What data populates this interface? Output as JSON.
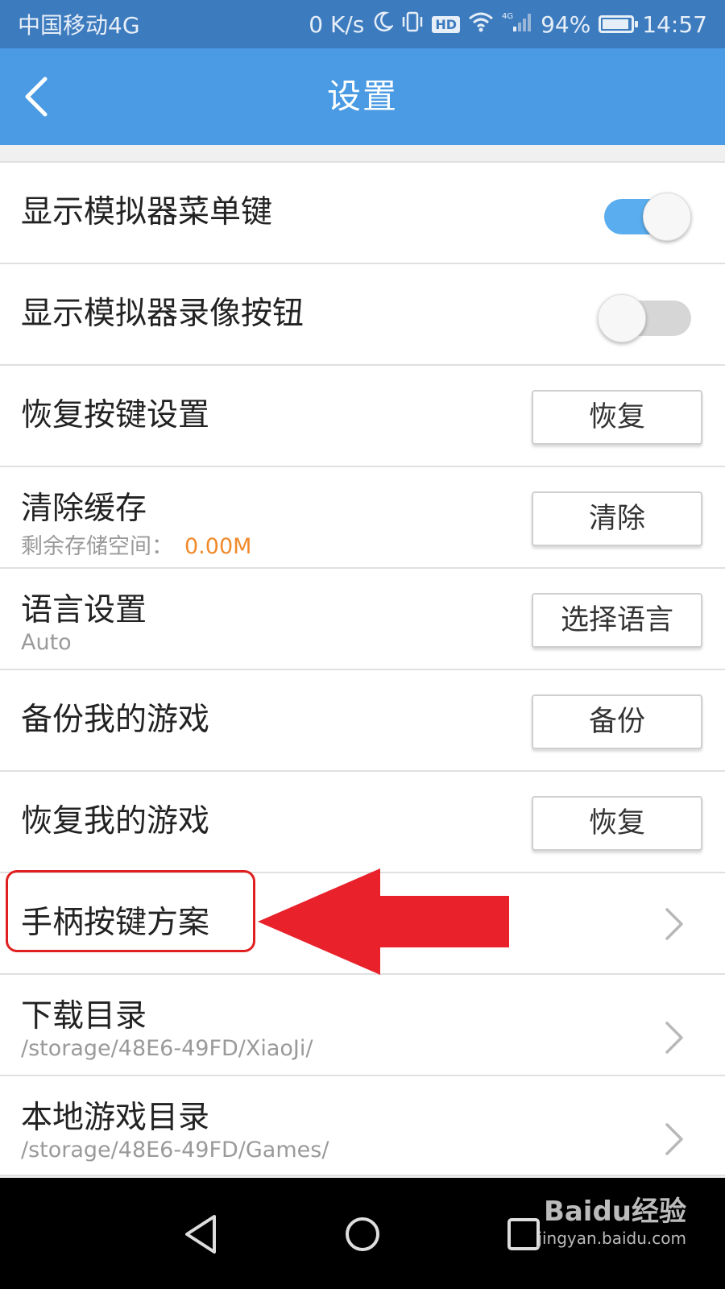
{
  "status_bar": {
    "carrier": "中国移动4G",
    "speed": "0 K/s",
    "hd": "HD",
    "net": "4G",
    "battery": "94%",
    "battery_level": 0.94,
    "time": "14:57"
  },
  "header": {
    "title": "设置"
  },
  "settings": {
    "show_menu_key": {
      "label": "显示模拟器菜单键",
      "on": true
    },
    "show_record_button": {
      "label": "显示模拟器录像按钮",
      "on": false
    },
    "restore_keys": {
      "label": "恢复按键设置",
      "button": "恢复"
    },
    "clear_cache": {
      "label": "清除缓存",
      "sub_label": "剩余存储空间：",
      "sub_value": "0.00M",
      "button": "清除"
    },
    "language": {
      "label": "语言设置",
      "sub": "Auto",
      "button": "选择语言"
    },
    "backup_games": {
      "label": "备份我的游戏",
      "button": "备份"
    },
    "restore_games": {
      "label": "恢复我的游戏",
      "button": "恢复"
    },
    "gamepad_scheme": {
      "label": "手柄按键方案"
    },
    "download_dir": {
      "label": "下载目录",
      "sub": "/storage/48E6-49FD/XiaoJi/"
    },
    "local_games_dir": {
      "label": "本地游戏目录",
      "sub": "/storage/48E6-49FD/Games/"
    }
  },
  "colors": {
    "status_bar": "#3d7bbf",
    "header": "#4a9be3",
    "toggle_on": "#5aaeef",
    "value_orange": "#f08a2c",
    "annotation_red": "#e02020"
  },
  "watermark": {
    "brand": "Baidu经验",
    "url": "jingyan.baidu.com"
  }
}
